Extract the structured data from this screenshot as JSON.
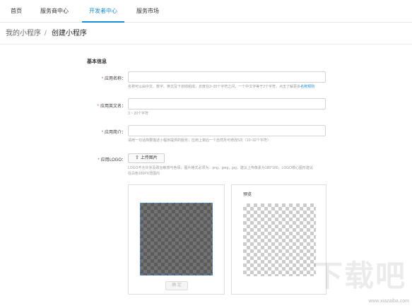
{
  "topnav": {
    "tabs": [
      {
        "label": "首页"
      },
      {
        "label": "服务商中心"
      },
      {
        "label": "开发者中心"
      },
      {
        "label": "服务市场"
      }
    ]
  },
  "breadcrumb": {
    "home": "我的小程序",
    "separator": "/",
    "current": "创建小程序"
  },
  "form": {
    "section_title": "基本信息",
    "name_label": "应用名称：",
    "name_hint": "名称可以由中文、数字、英文及下划线组成，长度在3~20个字符之间，一个中文字等于2个字符。点击了解更多",
    "name_hint_link": "名称规则",
    "en_name_label": "应用英文名：",
    "en_name_hint": "3 ~ 20个字符",
    "intro_label": "应用简介：",
    "intro_hint": "请用一句话简要描述小程序提供的服务；应用上架后一个自然月可修改5次（10~32个字符）",
    "logo_label": "应用LOGO：",
    "upload_label": "上传图片",
    "logo_hint1": "LOGO不允许涉及政治敏感与色情；图片格式必须为：png，jpeg，jpg，建议上传像素为180*180，LOGO核心图形建议",
    "logo_hint2": "在白色160PX范围内",
    "confirm_label": "确 定",
    "preview_label": "预览"
  },
  "watermark": {
    "site": "www.xiazaiba.com",
    "logo_text": "下载吧"
  },
  "colors": {
    "accent": "#1b8dd8",
    "required": "#e4393c"
  }
}
